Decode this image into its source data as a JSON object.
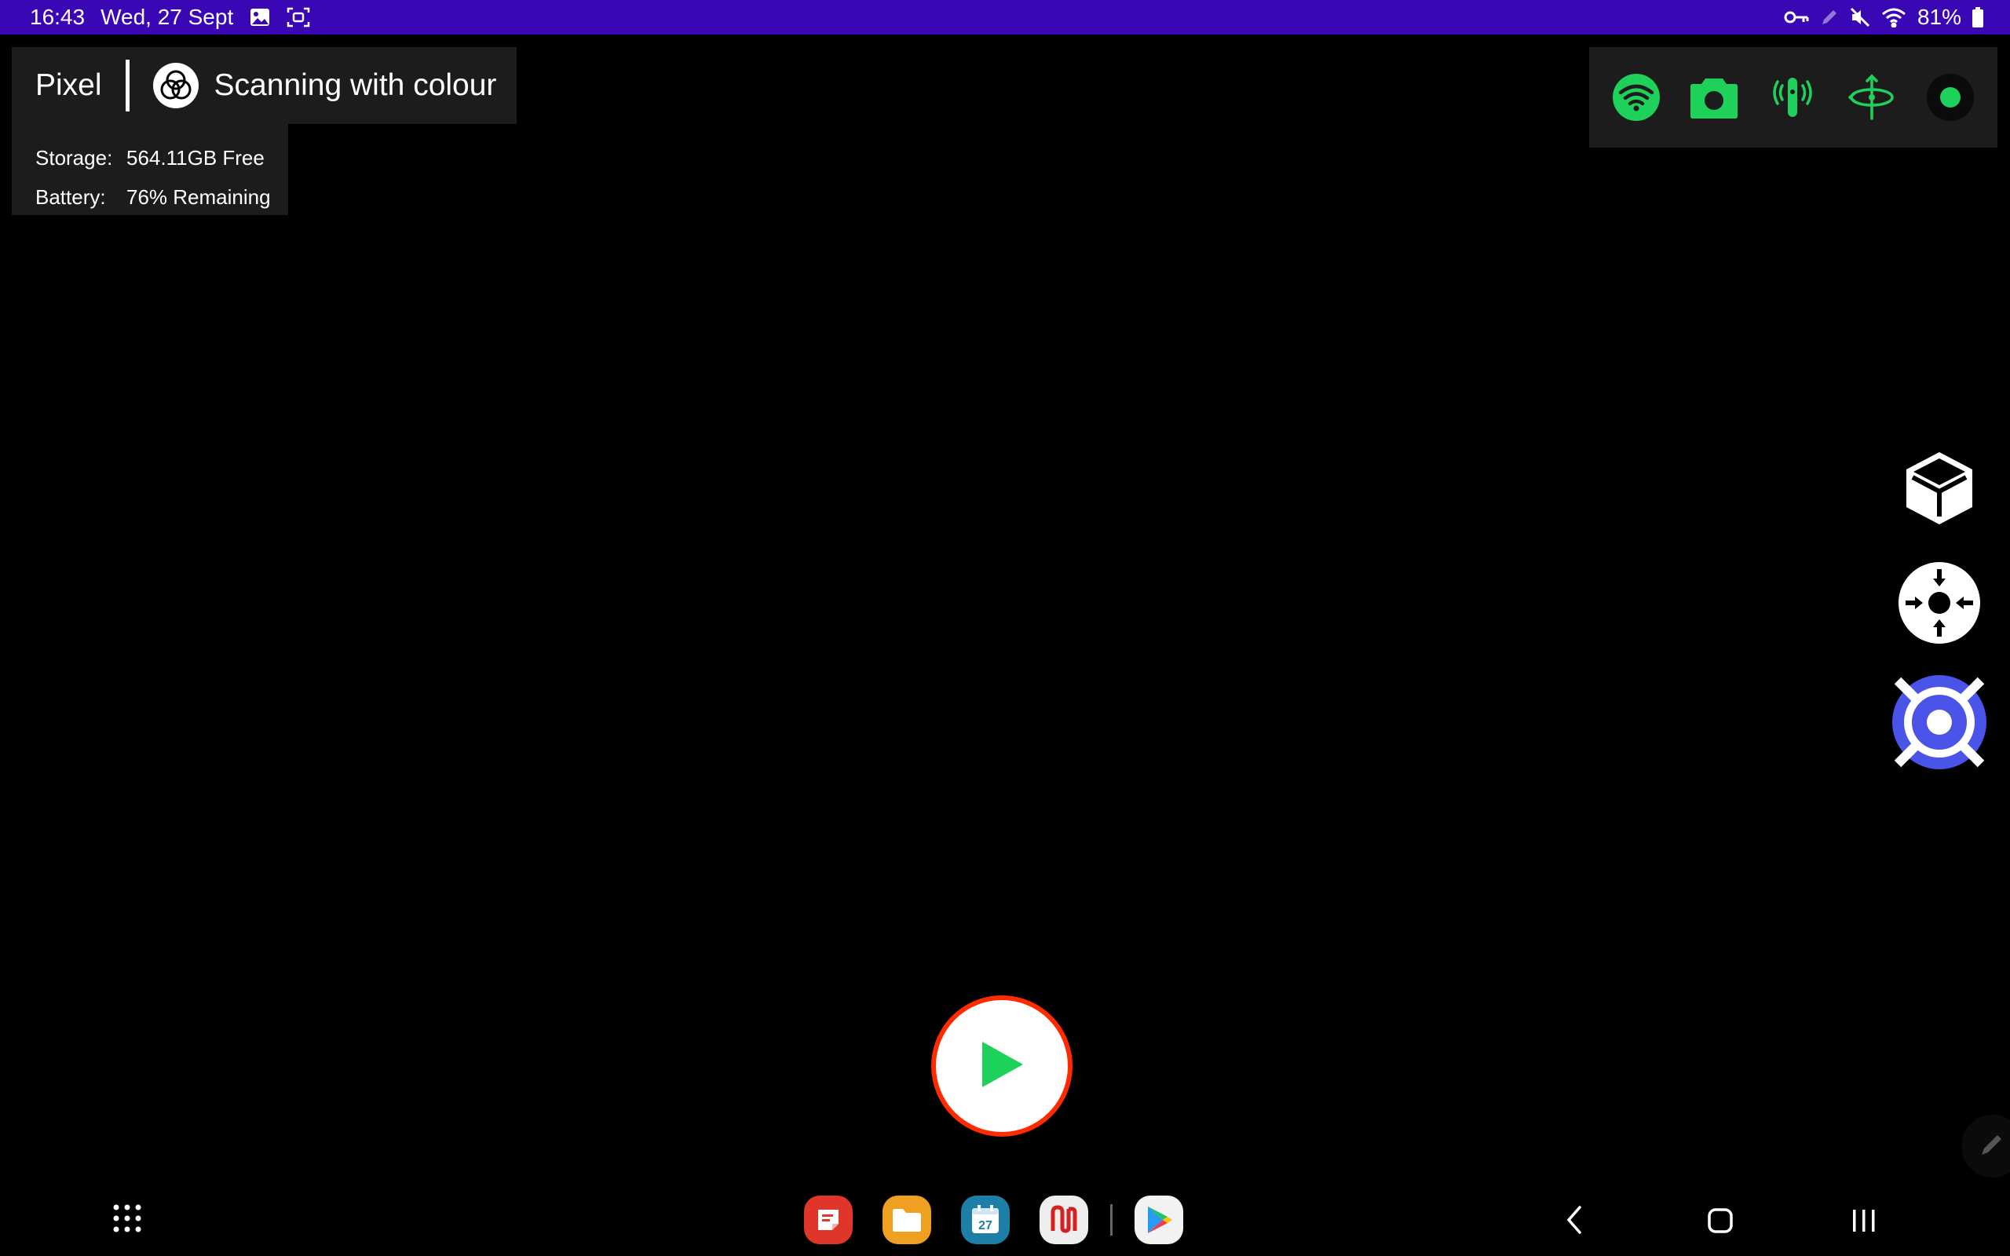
{
  "status_bar": {
    "time": "16:43",
    "date": "Wed, 27 Sept",
    "battery": "81%",
    "icons": [
      "gallery-icon",
      "screen-capture-icon",
      "key-icon",
      "pen-icon",
      "mute-icon",
      "wifi-icon",
      "battery-icon"
    ]
  },
  "device_panel": {
    "name": "Pixel",
    "mode_label": "Scanning with colour",
    "mode_icon": "colour-circles-icon"
  },
  "info_panel": {
    "storage_key": "Storage:",
    "storage_value": "564.11GB Free",
    "battery_key": "Battery:",
    "battery_value": "76% Remaining"
  },
  "indicators": {
    "color": "#1ed15a",
    "items": [
      "wifi-icon",
      "camera-icon",
      "signal-antenna-icon",
      "gimbal-rotation-icon",
      "record-dot-icon"
    ]
  },
  "side_controls": [
    "3d-cube-icon",
    "center-focus-icon",
    "target-scan-icon"
  ],
  "side_controls_accent": "#4a54e8",
  "play_button": {
    "icon": "play-icon",
    "ring_color": "#ff2a00",
    "icon_color": "#1ed15a"
  },
  "taskbar": {
    "apps_icon": "app-grid-icon",
    "dock": [
      {
        "name": "notes-app",
        "color": "#e0352b"
      },
      {
        "name": "files-app",
        "color": "#f0a020"
      },
      {
        "name": "calendar-app",
        "color": "#1d7fa8",
        "label": "27"
      },
      {
        "name": "red-logo-app",
        "color": "#eeeeee"
      },
      {
        "name": "play-store-app",
        "color": "#f2f2f2"
      }
    ],
    "nav": [
      "back-icon",
      "home-icon",
      "recents-icon"
    ]
  }
}
